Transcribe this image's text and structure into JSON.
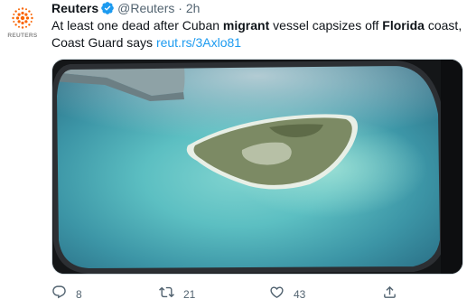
{
  "account": {
    "avatar_wordmark": "REUTERS",
    "display_name": "Reuters",
    "handle": "@Reuters",
    "separator": "·",
    "time": "2h"
  },
  "tweet": {
    "text_1": "At least one dead after Cuban ",
    "bold_1": "migrant",
    "text_2": " vessel capsizes off ",
    "bold_2": "Florida",
    "text_3": " coast, Coast Guard says ",
    "link": "reut.rs/3Axlo81"
  },
  "actions": {
    "reply_count": "8",
    "retweet_count": "21",
    "like_count": "43"
  },
  "icons": {
    "avatar": "reuters-logo-icon",
    "verified": "verified-badge-icon",
    "reply": "reply-icon",
    "retweet": "retweet-icon",
    "like": "heart-icon",
    "share": "share-icon"
  },
  "colors": {
    "link": "#1d9bf0",
    "verified": "#1d9bf0",
    "muted": "#536471",
    "reuters_orange": "#fa6400"
  }
}
